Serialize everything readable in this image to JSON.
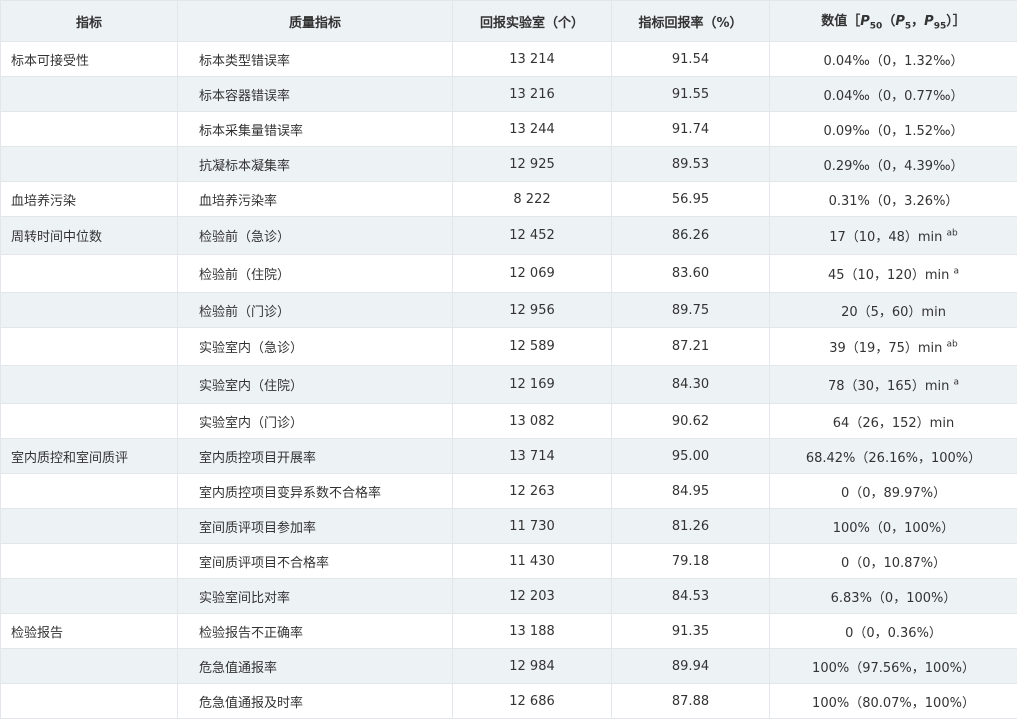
{
  "header": {
    "col_category": "指标",
    "col_indicator": "质量指标",
    "col_labs": "回报实验室（个）",
    "col_rate": "指标回报率（%）",
    "col_value_prefix": "数值［",
    "col_value_p": "P",
    "col_value_sub50": "50",
    "col_value_mid": "（",
    "col_value_sub5": "5",
    "col_value_comma": "，",
    "col_value_sub95": "95",
    "col_value_suffix": "）］"
  },
  "rows": [
    {
      "category": "标本可接受性",
      "indicator": "标本类型错误率",
      "labs": "13 214",
      "rate": "91.54",
      "value": "0.04‰（0，1.32‰）",
      "sup": ""
    },
    {
      "category": "",
      "indicator": "标本容器错误率",
      "labs": "13 216",
      "rate": "91.55",
      "value": "0.04‰（0，0.77‰）",
      "sup": ""
    },
    {
      "category": "",
      "indicator": "标本采集量错误率",
      "labs": "13 244",
      "rate": "91.74",
      "value": "0.09‰（0，1.52‰）",
      "sup": ""
    },
    {
      "category": "",
      "indicator": "抗凝标本凝集率",
      "labs": "12 925",
      "rate": "89.53",
      "value": "0.29‰（0，4.39‰）",
      "sup": ""
    },
    {
      "category": "血培养污染",
      "indicator": "血培养污染率",
      "labs": "8 222",
      "rate": "56.95",
      "value": "0.31%（0，3.26%）",
      "sup": ""
    },
    {
      "category": "周转时间中位数",
      "indicator": "检验前（急诊）",
      "labs": "12 452",
      "rate": "86.26",
      "value": "17（10，48）min ",
      "sup": "ab"
    },
    {
      "category": "",
      "indicator": "检验前（住院）",
      "labs": "12 069",
      "rate": "83.60",
      "value": "45（10，120）min ",
      "sup": "a"
    },
    {
      "category": "",
      "indicator": "检验前（门诊）",
      "labs": "12 956",
      "rate": "89.75",
      "value": "20（5，60）min",
      "sup": ""
    },
    {
      "category": "",
      "indicator": "实验室内（急诊）",
      "labs": "12 589",
      "rate": "87.21",
      "value": "39（19，75）min ",
      "sup": "ab"
    },
    {
      "category": "",
      "indicator": "实验室内（住院）",
      "labs": "12 169",
      "rate": "84.30",
      "value": "78（30，165）min ",
      "sup": "a"
    },
    {
      "category": "",
      "indicator": "实验室内（门诊）",
      "labs": "13 082",
      "rate": "90.62",
      "value": "64（26，152）min",
      "sup": ""
    },
    {
      "category": "室内质控和室间质评",
      "indicator": "室内质控项目开展率",
      "labs": "13 714",
      "rate": "95.00",
      "value": "68.42%（26.16%，100%）",
      "sup": ""
    },
    {
      "category": "",
      "indicator": "室内质控项目变异系数不合格率",
      "labs": "12 263",
      "rate": "84.95",
      "value": "0（0，89.97%）",
      "sup": ""
    },
    {
      "category": "",
      "indicator": "室间质评项目参加率",
      "labs": "11 730",
      "rate": "81.26",
      "value": "100%（0，100%）",
      "sup": ""
    },
    {
      "category": "",
      "indicator": "室间质评项目不合格率",
      "labs": "11 430",
      "rate": "79.18",
      "value": "0（0，10.87%）",
      "sup": ""
    },
    {
      "category": "",
      "indicator": "实验室间比对率",
      "labs": "12 203",
      "rate": "84.53",
      "value": "6.83%（0，100%）",
      "sup": ""
    },
    {
      "category": "检验报告",
      "indicator": "检验报告不正确率",
      "labs": "13 188",
      "rate": "91.35",
      "value": "0（0，0.36%）",
      "sup": ""
    },
    {
      "category": "",
      "indicator": "危急值通报率",
      "labs": "12 984",
      "rate": "89.94",
      "value": "100%（97.56%，100%）",
      "sup": ""
    },
    {
      "category": "",
      "indicator": "危急值通报及时率",
      "labs": "12 686",
      "rate": "87.88",
      "value": "100%（80.07%，100%）",
      "sup": ""
    }
  ]
}
